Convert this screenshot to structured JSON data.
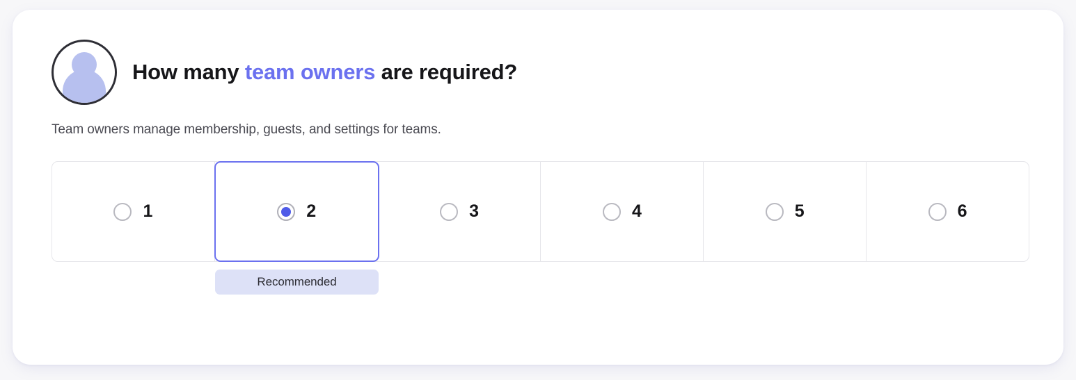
{
  "question": {
    "avatar_icon": "user-avatar-icon",
    "title_prefix": "How many ",
    "title_accent": "team owners",
    "title_suffix": " are required?",
    "description": "Team owners manage membership, guests, and settings for teams."
  },
  "options": {
    "selected_value": "2",
    "items": [
      {
        "label": "1",
        "selected": false
      },
      {
        "label": "2",
        "selected": true
      },
      {
        "label": "3",
        "selected": false
      },
      {
        "label": "4",
        "selected": false
      },
      {
        "label": "5",
        "selected": false
      },
      {
        "label": "6",
        "selected": false
      }
    ]
  },
  "badge": {
    "label": "Recommended"
  },
  "colors": {
    "accent": "#6b71ef",
    "radio_selected": "#4f5be8",
    "badge_bg": "#dde1f7",
    "avatar_fill": "#b7c0ef",
    "border": "#e6e6ea",
    "page_bg": "#f7f7f9",
    "card_bg": "#ffffff",
    "text": "#161619",
    "text_muted": "#4a4a52"
  }
}
